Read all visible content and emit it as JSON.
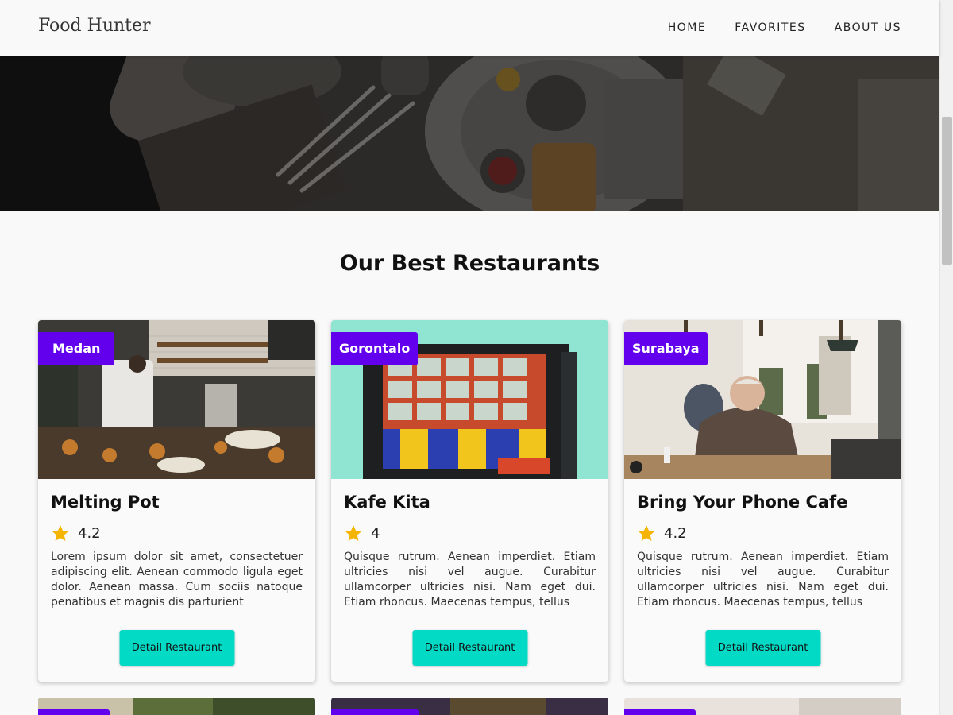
{
  "header": {
    "brand": "Food Hunter",
    "nav": [
      "HOME",
      "FAVORITES",
      "ABOUT US"
    ]
  },
  "section_title": "Our Best Restaurants",
  "restaurants": [
    {
      "city": "Medan",
      "name": "Melting Pot",
      "rating": "4.2",
      "description": "Lorem ipsum dolor sit amet, consectetuer adipiscing elit. Aenean commodo ligula eget dolor. Aenean massa. Cum sociis natoque penatibus et magnis dis parturient",
      "button": "Detail Restaurant"
    },
    {
      "city": "Gorontalo",
      "name": "Kafe Kita",
      "rating": "4",
      "description": "Quisque rutrum. Aenean imperdiet. Etiam ultricies nisi vel augue. Curabitur ullamcorper ultricies nisi. Nam eget dui. Etiam rhoncus. Maecenas tempus, tellus",
      "button": "Detail Restaurant"
    },
    {
      "city": "Surabaya",
      "name": "Bring Your Phone Cafe",
      "rating": "4.2",
      "description": "Quisque rutrum. Aenean imperdiet. Etiam ultricies nisi vel augue. Curabitur ullamcorper ultricies nisi. Nam eget dui. Etiam rhoncus. Maecenas tempus, tellus",
      "button": "Detail Restaurant"
    }
  ],
  "colors": {
    "primary": "#6200ee",
    "secondary": "#03dac6",
    "star": "#f5b400",
    "background": "#f9f9f9"
  },
  "icons": {
    "rating": "star-icon"
  }
}
